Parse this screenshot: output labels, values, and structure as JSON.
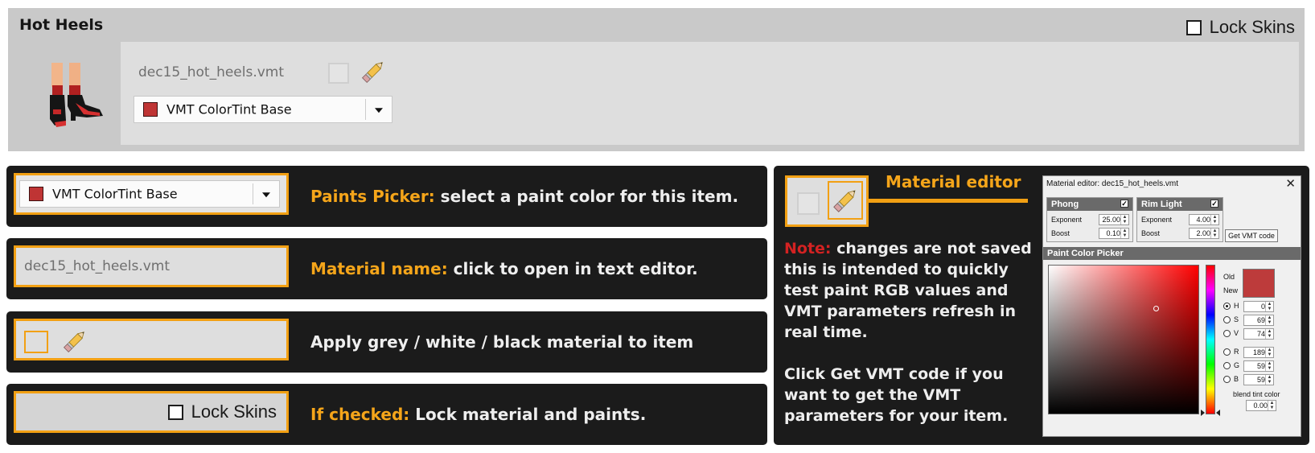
{
  "item_panel": {
    "title": "Hot Heels",
    "lock_skins_label": "Lock Skins",
    "material_name": "dec15_hot_heels.vmt",
    "paint_dropdown": {
      "selected": "VMT ColorTint Base",
      "swatch_color": "#bf3434"
    }
  },
  "legend": {
    "paints_picker": {
      "demo_selected": "VMT ColorTint Base",
      "highlight": "Paints Picker:",
      "text": " select a paint color for this item."
    },
    "material_name": {
      "demo_value": "dec15_hot_heels.vmt",
      "highlight": "Material name:",
      "text": " click to open in text editor."
    },
    "apply_material": {
      "text": "Apply grey / white / black material to item"
    },
    "lock_skins": {
      "demo_label": "Lock Skins",
      "highlight": "If checked:",
      "text": " Lock material and paints."
    }
  },
  "material_editor_info": {
    "title": "Material editor",
    "note_label": "Note:",
    "note_text": " changes are not saved this is intended to quickly test paint RGB values and VMT parameters refresh in real time.",
    "click_text": "Click Get VMT code if you want to get the VMT parameters for your item."
  },
  "material_editor_window": {
    "title": "Material editor: dec15_hot_heels.vmt",
    "close_glyph": "✕",
    "phong": {
      "label": "Phong",
      "checked": true,
      "exponent_label": "Exponent",
      "exponent": "25.00",
      "boost_label": "Boost",
      "boost": "0.10"
    },
    "rim_light": {
      "label": "Rim Light",
      "checked": true,
      "exponent_label": "Exponent",
      "exponent": "4.00",
      "boost_label": "Boost",
      "boost": "2.00"
    },
    "get_vmt_button": "Get VMT code",
    "paint_color_picker": {
      "header": "Paint Color Picker",
      "old_label": "Old",
      "new_label": "New",
      "preview_color": "#bd3b3b",
      "h_label": "H",
      "h": "0",
      "s_label": "S",
      "s": "69",
      "v_label": "V",
      "v": "74",
      "r_label": "R",
      "r": "189",
      "g_label": "G",
      "g": "59",
      "b_label": "B",
      "b": "59",
      "blend_label": "blend tint color",
      "blend": "0.00"
    }
  },
  "colors": {
    "accent": "#f5a51a",
    "note_red": "#d32222",
    "panel_dark": "#1b1b1b"
  }
}
